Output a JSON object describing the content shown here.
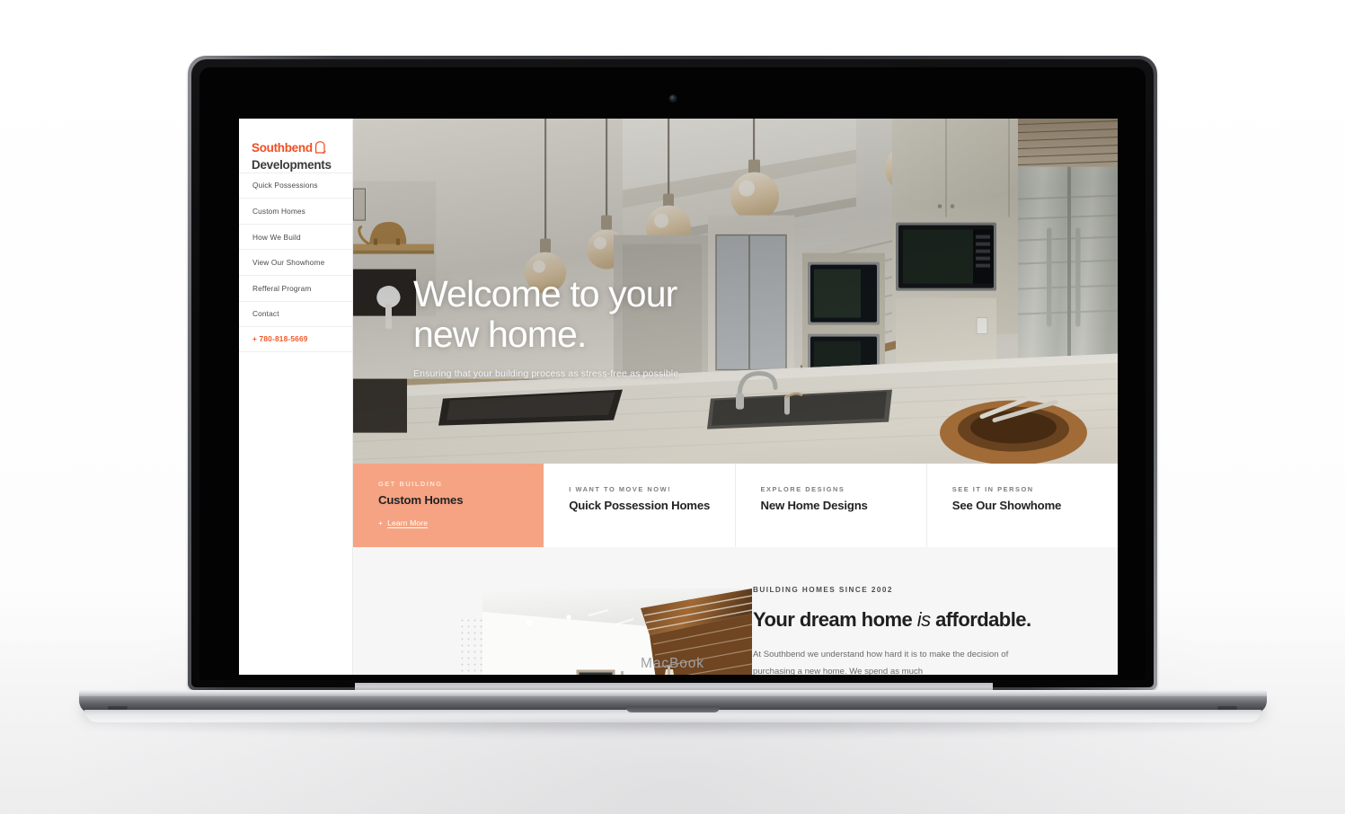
{
  "device": {
    "brand_label": "MacBook",
    "webcam": "webcam-dot"
  },
  "site": {
    "sidebar": {
      "logo": {
        "line1": "Southbend",
        "line2": "Developments",
        "mark": "house-arch-icon",
        "color_primary": "#f04e23",
        "color_secondary": "#3b3b3d"
      },
      "nav_items": [
        {
          "label": "Quick Possessions",
          "name": "quick-possessions"
        },
        {
          "label": "Custom Homes",
          "name": "custom-homes"
        },
        {
          "label": "How We Build",
          "name": "how-we-build"
        },
        {
          "label": "View Our Showhome",
          "name": "view-our-showhome"
        },
        {
          "label": "Refferal Program",
          "name": "refferal-program"
        },
        {
          "label": "Contact",
          "name": "contact"
        }
      ],
      "phone": "+ 780-818-5669"
    },
    "hero": {
      "title_line1": "Welcome to your",
      "title_line2": "new home.",
      "subtitle": "Ensuring that your building process as stress-free as possible.",
      "image_alt": "modern-kitchen-with-pendant-lights-marble-island"
    },
    "cards": [
      {
        "eyebrow": "GET BUILDING",
        "title": "Custom Homes",
        "link": "Learn More",
        "link_prefix": "+",
        "accent": true,
        "accent_color": "#f5a383"
      },
      {
        "eyebrow": "I WANT TO MOVE NOW!",
        "title": "Quick Possession Homes",
        "accent": false
      },
      {
        "eyebrow": "EXPLORE DESIGNS",
        "title": "New Home Designs",
        "accent": false
      },
      {
        "eyebrow": "SEE IT IN PERSON",
        "title": "See Our Showhome",
        "accent": false
      }
    ],
    "about": {
      "eyebrow": "BUILDING HOMES SINCE 2002",
      "title_pre": "Your dream home ",
      "title_em": "is",
      "title_post": " affordable.",
      "body": "At Southbend we understand how hard it is to make the decision of purchasing a new home.  We spend as much",
      "image_alt": "bright-white-interior-vaulted-ceiling-wall-sconces",
      "decoration": "dot-grid"
    }
  }
}
